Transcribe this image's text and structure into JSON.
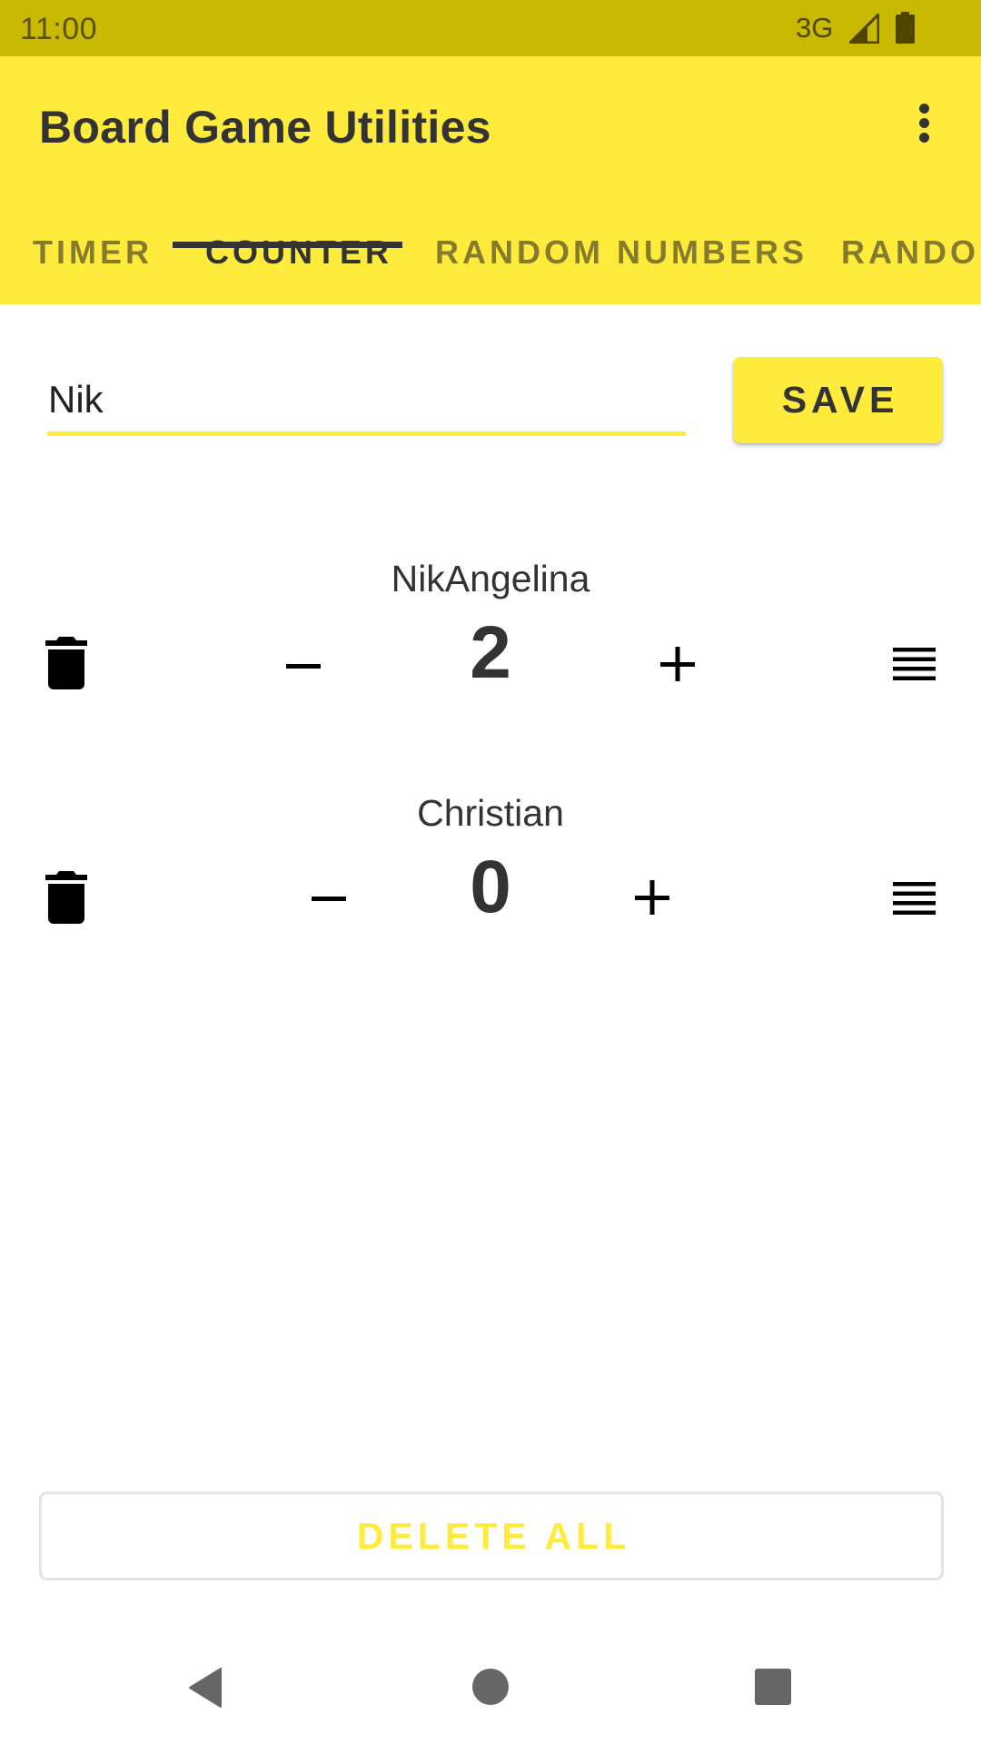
{
  "status_bar": {
    "time": "11:00",
    "network": "3G",
    "icons": [
      "signal-icon",
      "battery-icon"
    ]
  },
  "app_bar": {
    "title": "Board Game Utilities",
    "overflow_icon": "more-vert-icon"
  },
  "tabs": [
    {
      "label": "TIMER",
      "active": false
    },
    {
      "label": "COUNTER",
      "active": true
    },
    {
      "label": "RANDOM NUMBERS",
      "active": false
    },
    {
      "label": "RANDOM",
      "active": false
    }
  ],
  "name_input": {
    "value": "Nik",
    "placeholder": ""
  },
  "save_button": {
    "label": "SAVE"
  },
  "counters": [
    {
      "name": "NikAngelina",
      "score": "2",
      "icons": {
        "delete": "trash-icon",
        "decrement": "minus-icon",
        "increment": "plus-icon",
        "reorder": "reorder-icon"
      }
    },
    {
      "name": "Christian",
      "score": "0",
      "icons": {
        "delete": "trash-icon",
        "decrement": "minus-icon",
        "increment": "plus-icon",
        "reorder": "reorder-icon"
      }
    }
  ],
  "delete_all_button": {
    "label": "DELETE ALL"
  },
  "nav_bar": {
    "icons": [
      "back-icon",
      "home-icon",
      "recents-icon"
    ]
  },
  "colors": {
    "primary": "#FFEB3B",
    "primary_dark": "#C9B900",
    "text_dark": "#333333"
  }
}
